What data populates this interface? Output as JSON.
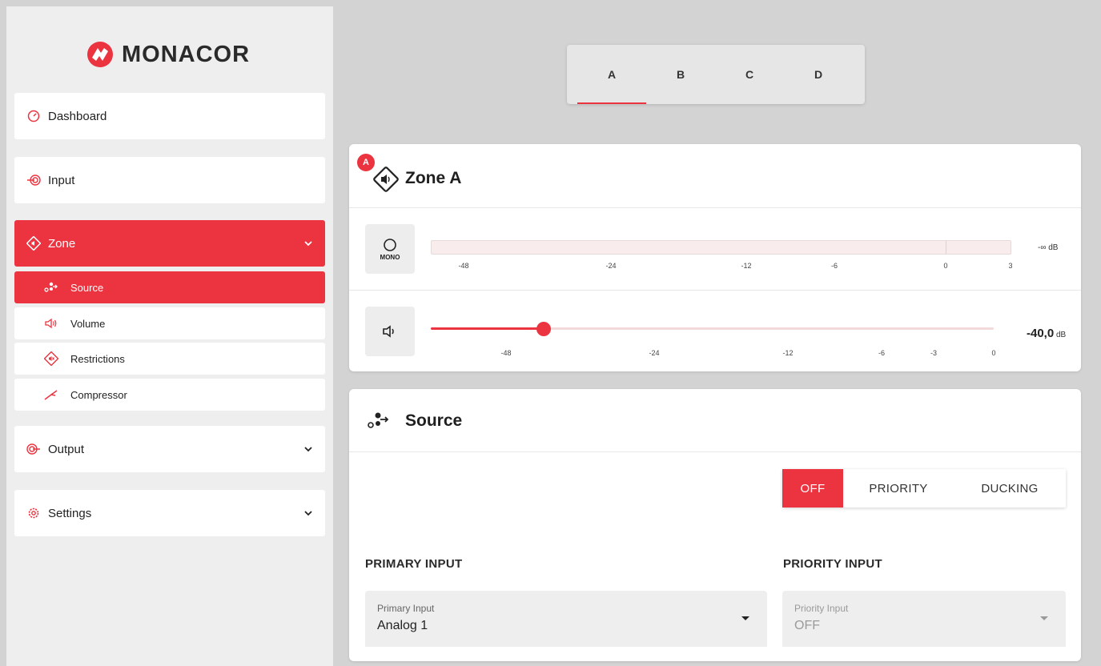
{
  "brand": {
    "name": "MONACOR",
    "accent": "#ec3440"
  },
  "sidebar": {
    "items": [
      {
        "label": "Dashboard",
        "icon": "gauge-icon"
      },
      {
        "label": "Input",
        "icon": "input-icon"
      },
      {
        "label": "Zone",
        "icon": "zone-icon",
        "expanded": true
      },
      {
        "label": "Output",
        "icon": "output-icon"
      },
      {
        "label": "Settings",
        "icon": "gear-icon"
      }
    ],
    "zone_sub": [
      {
        "label": "Source",
        "icon": "source-icon",
        "active": true
      },
      {
        "label": "Volume",
        "icon": "speaker-icon"
      },
      {
        "label": "Restrictions",
        "icon": "restrictions-icon"
      },
      {
        "label": "Compressor",
        "icon": "compressor-icon"
      }
    ]
  },
  "tabs": [
    "A",
    "B",
    "C",
    "D"
  ],
  "active_tab": "A",
  "zone_card": {
    "badge": "A",
    "title": "Zone A",
    "mono_label": "MONO",
    "meter": {
      "ticks": [
        "-48",
        "-24",
        "-12",
        "-6",
        "0",
        "3"
      ],
      "readout_value": "-∞",
      "readout_unit": "dB"
    },
    "volume": {
      "ticks": [
        "-48",
        "-24",
        "-12",
        "-6",
        "-3",
        "0"
      ],
      "readout_value": "-40,0",
      "readout_unit": "dB",
      "level_fraction": 0.2
    }
  },
  "source_card": {
    "title": "Source",
    "modes": [
      "OFF",
      "PRIORITY",
      "DUCKING"
    ],
    "active_mode": "OFF",
    "primary": {
      "section": "PRIMARY INPUT",
      "label": "Primary Input",
      "value": "Analog 1"
    },
    "priority": {
      "section": "PRIORITY INPUT",
      "label": "Priority Input",
      "value": "OFF"
    }
  }
}
